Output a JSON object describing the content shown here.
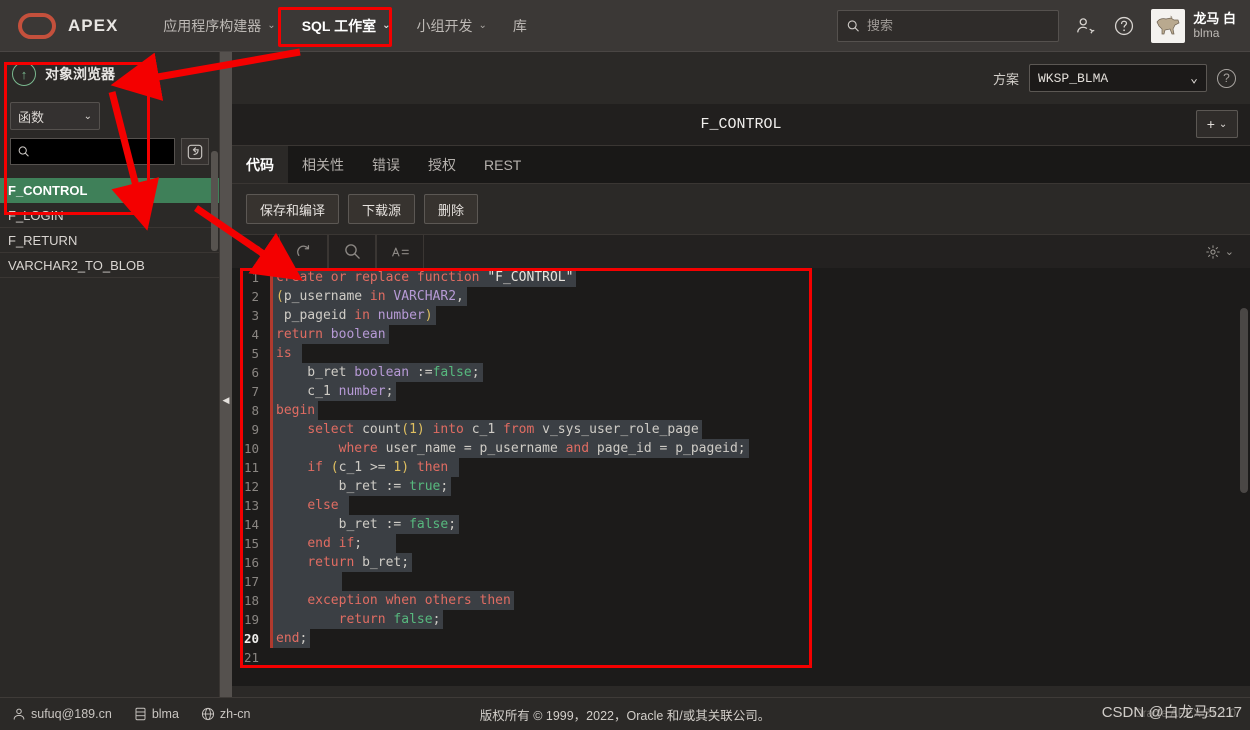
{
  "app": {
    "brand": "APEX",
    "logo_color": "#c4503c"
  },
  "topnav": {
    "items": [
      {
        "label": "应用程序构建器",
        "caret": "⌄",
        "active": false
      },
      {
        "label": "SQL 工作室",
        "caret": "⌄",
        "active": true
      },
      {
        "label": "小组开发",
        "caret": "⌄",
        "active": false
      },
      {
        "label": "库",
        "caret": "",
        "active": false
      }
    ],
    "search": {
      "placeholder": "搜索",
      "value": "",
      "icon": "search-icon"
    },
    "icons": [
      "add-user-icon",
      "help-icon"
    ],
    "user": {
      "name": "龙马 白",
      "handle": "blma",
      "avatar": "horse-avatar"
    }
  },
  "sidebar": {
    "title": "对象浏览器",
    "collapse_icon": "↑",
    "type_select": {
      "value": "函数",
      "caret": "⌄"
    },
    "search": {
      "placeholder": "",
      "value": "",
      "icon": "search-icon"
    },
    "reset_icon": "reset-icon",
    "items": [
      {
        "label": "F_CONTROL",
        "selected": true
      },
      {
        "label": "F_LOGIN",
        "selected": false
      },
      {
        "label": "F_RETURN",
        "selected": false
      },
      {
        "label": "VARCHAR2_TO_BLOB",
        "selected": false
      }
    ],
    "selected_color": "#3f8059"
  },
  "main": {
    "schema_label": "方案",
    "schema_value": "WKSP_BLMA",
    "schema_caret": "⌄",
    "help_icon": "?",
    "object_title": "F_CONTROL",
    "add_button": {
      "plus": "+",
      "caret": "⌄"
    },
    "tabs": [
      {
        "label": "代码",
        "active": true
      },
      {
        "label": "相关性",
        "active": false
      },
      {
        "label": "错误",
        "active": false
      },
      {
        "label": "授权",
        "active": false
      },
      {
        "label": "REST",
        "active": false
      }
    ],
    "buttons": [
      {
        "label": "保存和编译"
      },
      {
        "label": "下载源"
      },
      {
        "label": "删除"
      }
    ],
    "editor_toolbar": [
      {
        "icon": "undo-icon"
      },
      {
        "icon": "redo-icon"
      },
      {
        "icon": "find-icon"
      },
      {
        "icon": "format-icon"
      }
    ],
    "settings_icon": "gear-icon",
    "settings_caret": "⌄"
  },
  "code": {
    "lines": [
      {
        "n": 1,
        "cur": false,
        "tokens": [
          {
            "t": "create or replace function ",
            "c": "k"
          },
          {
            "t": "\"F_CONTROL\"",
            "c": "st"
          }
        ]
      },
      {
        "n": 2,
        "cur": false,
        "tokens": [
          {
            "t": "(",
            "c": "pn"
          },
          {
            "t": "p_username ",
            "c": "id"
          },
          {
            "t": "in ",
            "c": "k"
          },
          {
            "t": "VARCHAR2",
            "c": "ty"
          },
          {
            "t": ",",
            "c": "id"
          }
        ]
      },
      {
        "n": 3,
        "cur": false,
        "tokens": [
          {
            "t": " p_pageid ",
            "c": "id"
          },
          {
            "t": "in ",
            "c": "k"
          },
          {
            "t": "number",
            "c": "ty"
          },
          {
            "t": ")",
            "c": "pn"
          }
        ]
      },
      {
        "n": 4,
        "cur": false,
        "tokens": [
          {
            "t": "return ",
            "c": "k"
          },
          {
            "t": "boolean",
            "c": "ty"
          }
        ]
      },
      {
        "n": 5,
        "cur": false,
        "tokens": [
          {
            "t": "is ",
            "c": "k"
          }
        ]
      },
      {
        "n": 6,
        "cur": false,
        "tokens": [
          {
            "t": "    b_ret ",
            "c": "id"
          },
          {
            "t": "boolean ",
            "c": "ty"
          },
          {
            "t": ":=",
            "c": "id"
          },
          {
            "t": "false",
            "c": "bl"
          },
          {
            "t": ";",
            "c": "id"
          }
        ]
      },
      {
        "n": 7,
        "cur": false,
        "tokens": [
          {
            "t": "    c_1 ",
            "c": "id"
          },
          {
            "t": "number",
            "c": "ty"
          },
          {
            "t": ";",
            "c": "id"
          }
        ]
      },
      {
        "n": 8,
        "cur": false,
        "tokens": [
          {
            "t": "begin",
            "c": "k"
          }
        ]
      },
      {
        "n": 9,
        "cur": false,
        "tokens": [
          {
            "t": "    ",
            "c": "id"
          },
          {
            "t": "select ",
            "c": "k"
          },
          {
            "t": "count",
            "c": "id"
          },
          {
            "t": "(",
            "c": "pn"
          },
          {
            "t": "1",
            "c": "pn"
          },
          {
            "t": ") ",
            "c": "pn"
          },
          {
            "t": "into ",
            "c": "k"
          },
          {
            "t": "c_1 ",
            "c": "id"
          },
          {
            "t": "from ",
            "c": "k"
          },
          {
            "t": "v_sys_user_role_page",
            "c": "id"
          }
        ]
      },
      {
        "n": 10,
        "cur": false,
        "tokens": [
          {
            "t": "        ",
            "c": "id"
          },
          {
            "t": "where ",
            "c": "k"
          },
          {
            "t": "user_name = p_username ",
            "c": "id"
          },
          {
            "t": "and ",
            "c": "k"
          },
          {
            "t": "page_id = p_pageid;",
            "c": "id"
          }
        ]
      },
      {
        "n": 11,
        "cur": false,
        "tokens": [
          {
            "t": "    ",
            "c": "id"
          },
          {
            "t": "if ",
            "c": "k"
          },
          {
            "t": "(",
            "c": "pn"
          },
          {
            "t": "c_1 ",
            "c": "id"
          },
          {
            "t": ">= ",
            "c": "id"
          },
          {
            "t": "1",
            "c": "pn"
          },
          {
            "t": ") ",
            "c": "pn"
          },
          {
            "t": "then ",
            "c": "k"
          }
        ]
      },
      {
        "n": 12,
        "cur": false,
        "tokens": [
          {
            "t": "        b_ret := ",
            "c": "id"
          },
          {
            "t": "true",
            "c": "bl"
          },
          {
            "t": ";",
            "c": "id"
          }
        ]
      },
      {
        "n": 13,
        "cur": false,
        "tokens": [
          {
            "t": "    ",
            "c": "id"
          },
          {
            "t": "else ",
            "c": "k"
          }
        ]
      },
      {
        "n": 14,
        "cur": false,
        "tokens": [
          {
            "t": "        b_ret := ",
            "c": "id"
          },
          {
            "t": "false",
            "c": "bl"
          },
          {
            "t": ";",
            "c": "id"
          }
        ]
      },
      {
        "n": 15,
        "cur": false,
        "tokens": [
          {
            "t": "    ",
            "c": "id"
          },
          {
            "t": "end if",
            "c": "k"
          },
          {
            "t": ";    ",
            "c": "id"
          }
        ]
      },
      {
        "n": 16,
        "cur": false,
        "tokens": [
          {
            "t": "    ",
            "c": "id"
          },
          {
            "t": "return ",
            "c": "k"
          },
          {
            "t": "b_ret;",
            "c": "id"
          }
        ]
      },
      {
        "n": 17,
        "cur": false,
        "tokens": [
          {
            "t": "        ",
            "c": "id"
          }
        ]
      },
      {
        "n": 18,
        "cur": false,
        "tokens": [
          {
            "t": "    ",
            "c": "id"
          },
          {
            "t": "exception when others then",
            "c": "k"
          }
        ]
      },
      {
        "n": 19,
        "cur": false,
        "tokens": [
          {
            "t": "        ",
            "c": "id"
          },
          {
            "t": "return ",
            "c": "k"
          },
          {
            "t": "false",
            "c": "bl"
          },
          {
            "t": ";",
            "c": "id"
          }
        ]
      },
      {
        "n": 20,
        "cur": true,
        "tokens": [
          {
            "t": "end",
            "c": "k"
          },
          {
            "t": ";",
            "c": "id"
          }
        ]
      },
      {
        "n": 21,
        "cur": false,
        "tokens": []
      }
    ]
  },
  "footer": {
    "user_email": "sufuq@189.cn",
    "db": "blma",
    "locale": "zh-cn",
    "copyright": "版权所有 © 1999，2022，Oracle 和/或其关联公司。",
    "version": "Oracle APEX 21.1.0",
    "watermark": "CSDN @白龙马5217"
  },
  "annotations": {
    "highlight_color": "#f40000"
  }
}
